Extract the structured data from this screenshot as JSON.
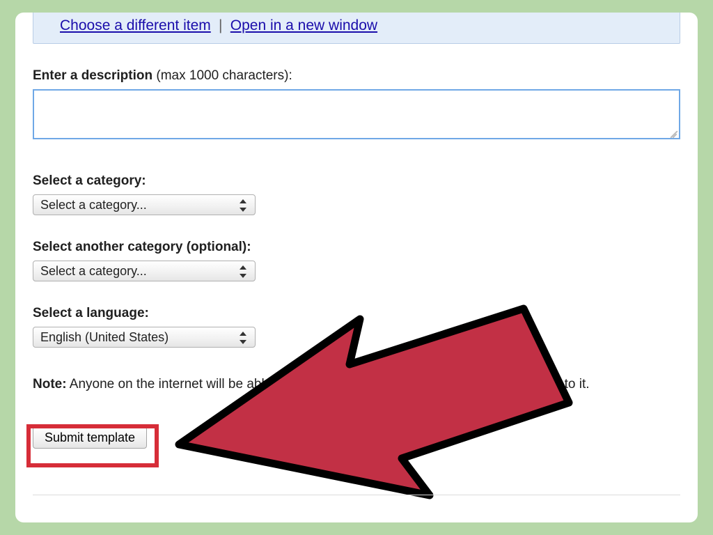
{
  "banner": {
    "link1": "Choose a different item",
    "link2": "Open in a new window",
    "sep": "|"
  },
  "description": {
    "label_bold": "Enter a description",
    "label_suffix": " (max 1000 characters):",
    "value": ""
  },
  "category": {
    "label": "Select a category:",
    "selected": "Select a category..."
  },
  "category2": {
    "label": "Select another category (optional):",
    "selected": "Select a category..."
  },
  "language": {
    "label": "Select a language:",
    "selected": "English (United States)"
  },
  "note": {
    "bold": "Note:",
    "text": " Anyone on the internet will be able to find your template and any changes you make to it."
  },
  "submit": {
    "label": "Submit template"
  }
}
